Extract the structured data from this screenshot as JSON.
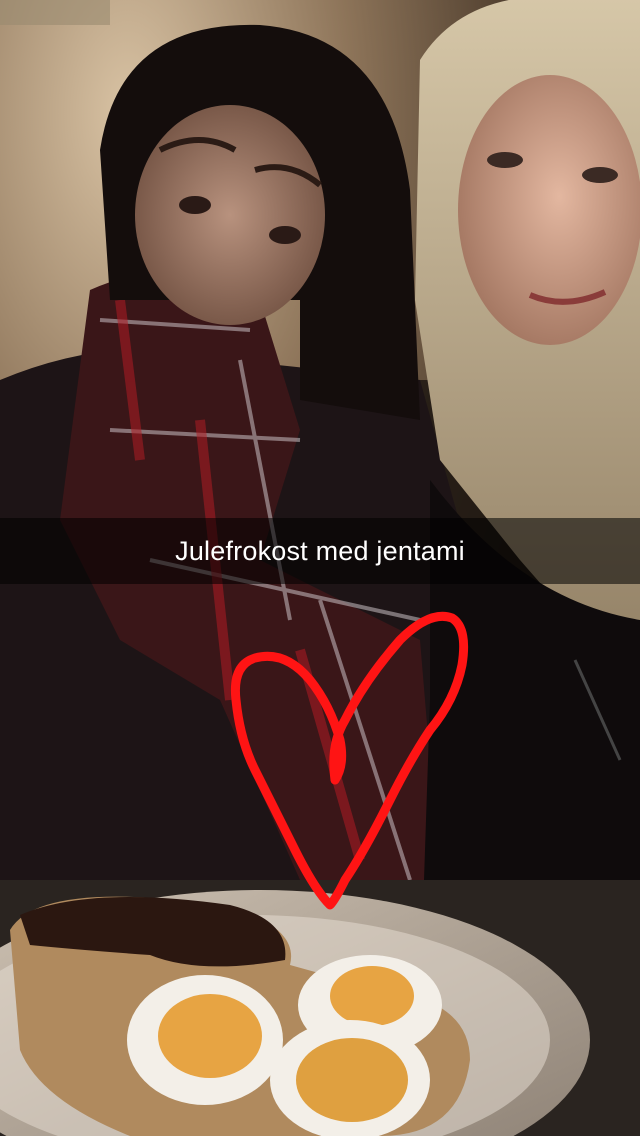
{
  "snap": {
    "caption": "Julefrokost med jentami",
    "drawing": "heart",
    "drawing_color": "#ff1414"
  },
  "photo": {
    "description_icon": "selfie-photo"
  }
}
